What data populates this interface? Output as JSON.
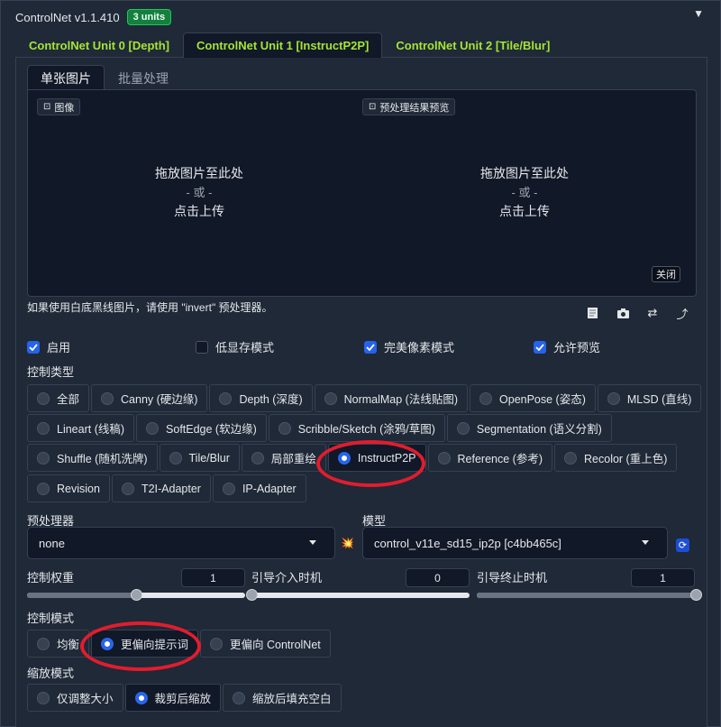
{
  "header": {
    "title": "ControlNet v1.1.410",
    "badge": "3 units",
    "collapse_glyph": "▼"
  },
  "unit_tabs": [
    {
      "label": "ControlNet Unit 0 [Depth]",
      "active": false
    },
    {
      "label": "ControlNet Unit 1 [InstructP2P]",
      "active": true
    },
    {
      "label": "ControlNet Unit 2 [Tile/Blur]",
      "active": false
    }
  ],
  "image_tabs": [
    {
      "label": "单张图片",
      "active": true
    },
    {
      "label": "批量处理",
      "active": false
    }
  ],
  "upload": {
    "left_chip": "图像",
    "right_chip": "预处理结果预览",
    "drop_line1": "拖放图片至此处",
    "drop_or": "- 或 -",
    "drop_line2": "点击上传",
    "close_label": "关闭"
  },
  "hint": "如果使用白底黑线图片，请使用 \"invert\" 预处理器。",
  "toolbar_icons": [
    "edit-icon",
    "camera-icon",
    "swap-icon",
    "send-icon"
  ],
  "checkboxes": [
    {
      "label": "启用",
      "checked": true
    },
    {
      "label": "低显存模式",
      "checked": false
    },
    {
      "label": "完美像素模式",
      "checked": true
    },
    {
      "label": "允许预览",
      "checked": true
    }
  ],
  "control_type": {
    "label": "控制类型",
    "rows": [
      [
        "全部",
        "Canny (硬边缘)",
        "Depth (深度)",
        "NormalMap (法线贴图)",
        "OpenPose (姿态)",
        "MLSD (直线)"
      ],
      [
        "Lineart (线稿)",
        "SoftEdge (软边缘)",
        "Scribble/Sketch (涂鸦/草图)",
        "Segmentation (语义分割)"
      ],
      [
        "Shuffle (随机洗牌)",
        "Tile/Blur",
        "局部重绘",
        "InstructP2P",
        "Reference (参考)",
        "Recolor (重上色)"
      ],
      [
        "Revision",
        "T2I-Adapter",
        "IP-Adapter"
      ]
    ],
    "selected": "InstructP2P"
  },
  "preprocessor": {
    "label": "预处理器",
    "value": "none"
  },
  "model": {
    "label": "模型",
    "value": "control_v11e_sd15_ip2p [c4bb465c]"
  },
  "sliders": [
    {
      "label": "控制权重",
      "value": "1",
      "min": 0,
      "max": 2,
      "current": 1
    },
    {
      "label": "引导介入时机",
      "value": "0",
      "min": 0,
      "max": 1,
      "current": 0
    },
    {
      "label": "引导终止时机",
      "value": "1",
      "min": 0,
      "max": 1,
      "current": 1
    }
  ],
  "control_mode": {
    "label": "控制模式",
    "options": [
      "均衡",
      "更偏向提示词",
      "更偏向 ControlNet"
    ],
    "selected": "更偏向提示词"
  },
  "resize_mode": {
    "label": "缩放模式",
    "options": [
      "仅调整大小",
      "裁剪后缩放",
      "缩放后填充空白"
    ],
    "selected": "裁剪后缩放"
  },
  "colors": {
    "accent": "#2563eb",
    "tab_text": "#a3e635",
    "annotation": "#e11d2e",
    "badge": "#15803d"
  }
}
